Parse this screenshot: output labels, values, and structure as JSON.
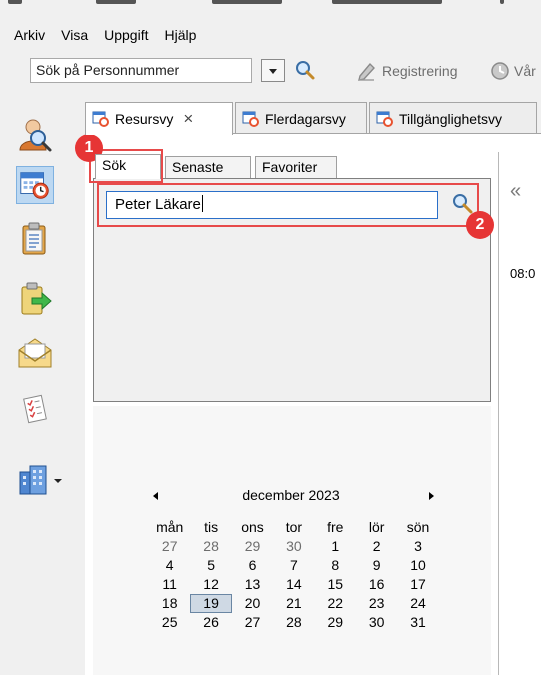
{
  "menubar": {
    "items": [
      "Arkiv",
      "Visa",
      "Uppgift",
      "Hjälp"
    ]
  },
  "toolbar": {
    "search_combo_text": "Sök på Personnummer",
    "registration_label": "Registrering",
    "right_label_clipped": "Vår"
  },
  "tabs": [
    {
      "label": "Resursvy",
      "active": true,
      "closable": true
    },
    {
      "label": "Flerdagarsvy",
      "active": false
    },
    {
      "label": "Tillgänglighetsvy",
      "active": false
    }
  ],
  "subtabs": [
    "Sök",
    "Senaste",
    "Favoriter"
  ],
  "search": {
    "value": "Peter Läkare"
  },
  "calendar": {
    "month_label": "december 2023",
    "weekdays": [
      "mån",
      "tis",
      "ons",
      "tor",
      "fre",
      "lör",
      "sön"
    ],
    "weeks": [
      [
        "27",
        "28",
        "29",
        "30",
        "1",
        "2",
        "3"
      ],
      [
        "4",
        "5",
        "6",
        "7",
        "8",
        "9",
        "10"
      ],
      [
        "11",
        "12",
        "13",
        "14",
        "15",
        "16",
        "17"
      ],
      [
        "18",
        "19",
        "20",
        "21",
        "22",
        "23",
        "24"
      ],
      [
        "25",
        "26",
        "27",
        "28",
        "29",
        "30",
        "31"
      ]
    ],
    "today": "19"
  },
  "right": {
    "collapse_glyph": "«",
    "time_label": "08:0"
  },
  "annotations": {
    "badge1": "1",
    "badge2": "2"
  },
  "colors": {
    "highlight": "#e74a4a",
    "badge": "#e63535",
    "selection": "#bcd8f2"
  }
}
